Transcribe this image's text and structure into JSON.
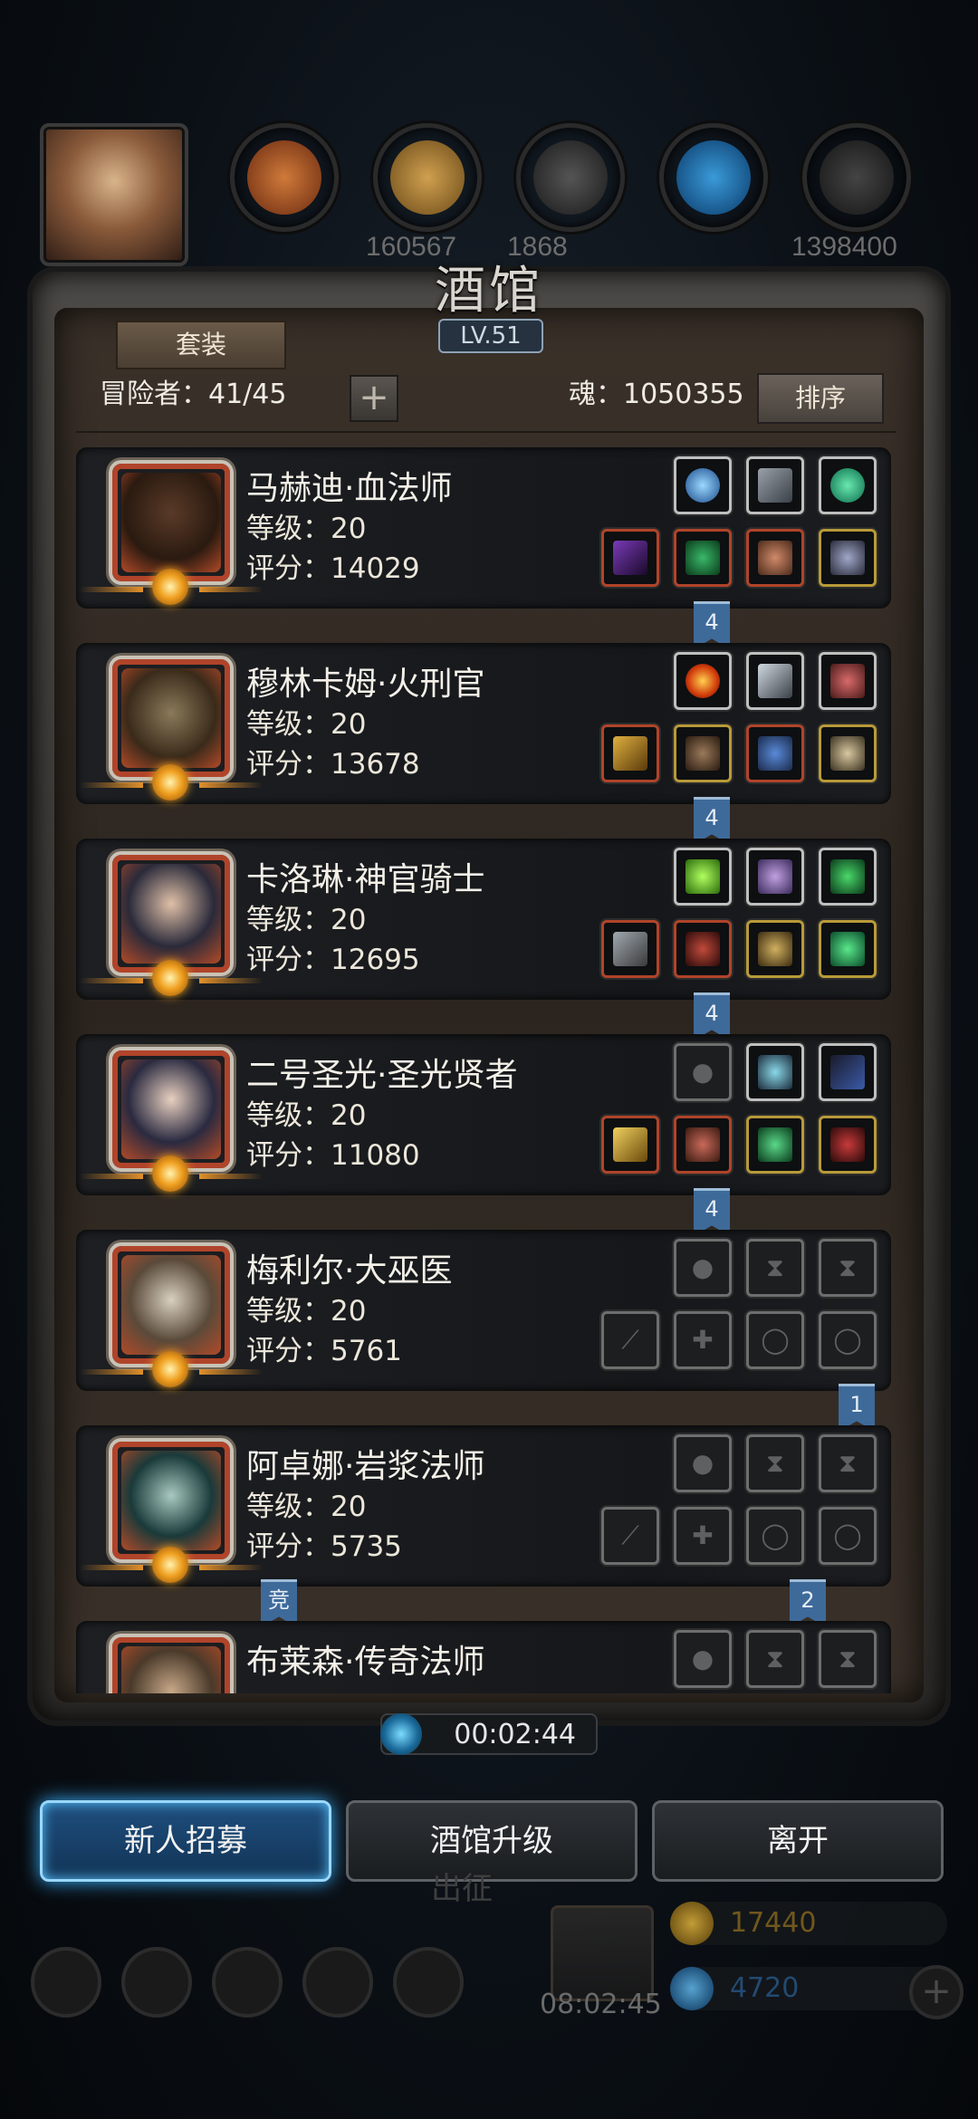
{
  "resources": {
    "values": [
      "",
      "160567",
      "1868",
      "",
      "1398400"
    ],
    "clock": "08:02:45"
  },
  "tavern": {
    "title": "酒馆",
    "level": "LV.51",
    "tab_label": "套装",
    "adventurers": "冒险者：41/45",
    "soul": "魂：1050355",
    "sort_label": "排序"
  },
  "heroes": [
    {
      "name": "马赫迪·血法师",
      "level": "等级：20",
      "score": "评分：14029",
      "flag": "4"
    },
    {
      "name": "穆林卡姆·火刑官",
      "level": "等级：20",
      "score": "评分：13678",
      "flag": "4"
    },
    {
      "name": "卡洛琳·神官骑士",
      "level": "等级：20",
      "score": "评分：12695",
      "flag": "4"
    },
    {
      "name": "二号圣光·圣光贤者",
      "level": "等级：20",
      "score": "评分：11080",
      "flag": "4"
    },
    {
      "name": "梅利尔·大巫医",
      "level": "等级：20",
      "score": "评分：5761",
      "flag": "1"
    },
    {
      "name": "阿卓娜·岩浆法师",
      "level": "等级：20",
      "score": "评分：5735",
      "flag": "2",
      "flag_left": "竞"
    },
    {
      "name": "布莱森·传奇法师",
      "level": "",
      "score": ""
    }
  ],
  "timer": "00:02:44",
  "buttons": {
    "recruit": "新人招募",
    "upgrade": "酒馆升级",
    "leave": "离开"
  },
  "behind": {
    "expedition": "出征",
    "gold": "17440",
    "gems": "4720"
  },
  "colors": {
    "frame": "#2b2a28",
    "panel": "#2c251f",
    "row_bg": "#1d1f22",
    "flag": "#3e6a9a",
    "primary_glow": "#3ab0ff"
  }
}
